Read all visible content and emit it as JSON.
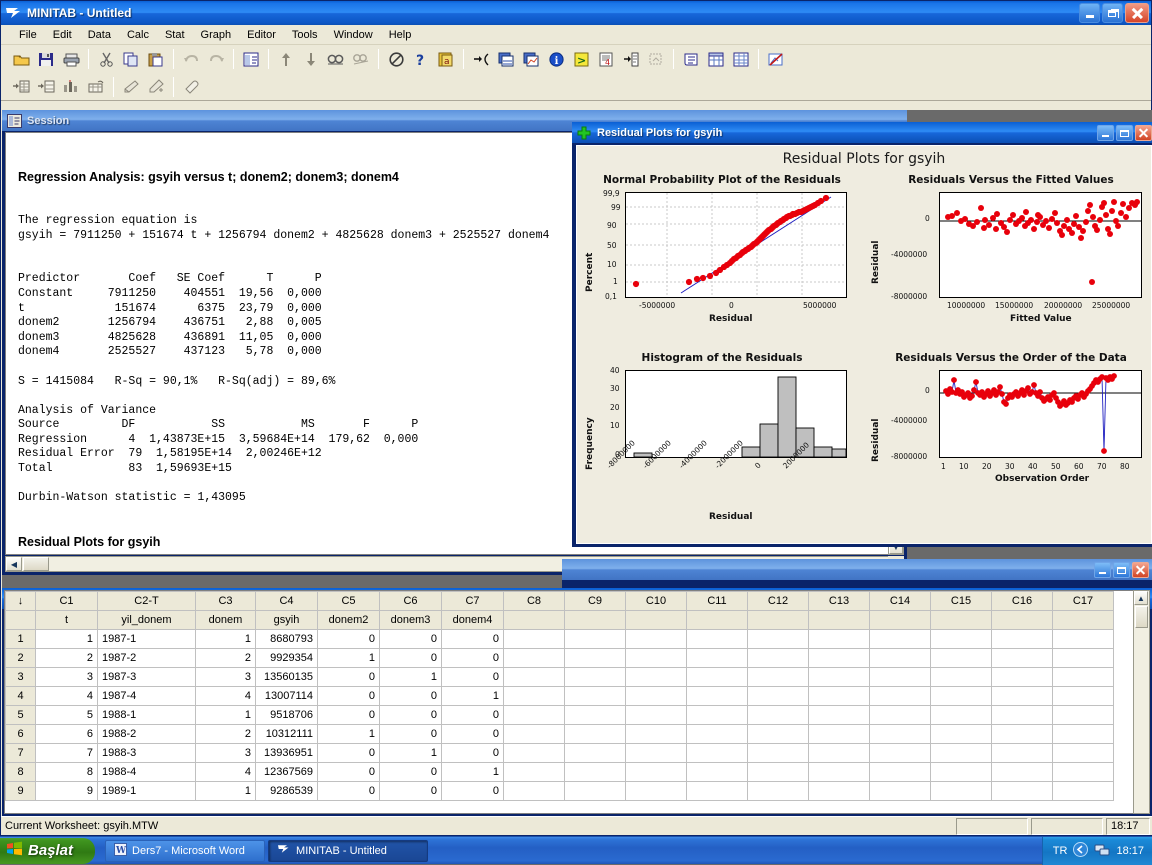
{
  "window": {
    "title": "MINITAB - Untitled",
    "icon": "minitab-icon",
    "buttons": {
      "minimize": "Minimize",
      "restore": "Restore",
      "close": "Close"
    }
  },
  "menubar": {
    "items": [
      "File",
      "Edit",
      "Data",
      "Calc",
      "Stat",
      "Graph",
      "Editor",
      "Tools",
      "Window",
      "Help"
    ]
  },
  "toolbar_main": {
    "icons": [
      "open-folder-icon",
      "save-icon",
      "print-icon",
      "cut-icon",
      "copy-icon",
      "paste-icon",
      "undo-icon",
      "redo-icon",
      "session-window-icon",
      "arrow-up-icon",
      "arrow-down-icon",
      "find-icon",
      "find-next-icon",
      "cancel-icon",
      "help-icon",
      "stat-guide-icon",
      "next-command-icon",
      "new-graph-window-icon",
      "new-graph-icon",
      "info-icon",
      "history-icon",
      "report-pad-icon",
      "copy-to-worksheet-icon",
      "show-graphs-icon",
      "session-icon",
      "project-manager-icon",
      "worksheet-icon",
      "graph-layout-icon"
    ]
  },
  "toolbar_worksheet": {
    "icons": [
      "insert-cells-icon",
      "insert-rows-icon",
      "insert-columns-icon",
      "move-columns-icon",
      "brush-icon",
      "brush-plus-icon",
      "eraser-icon"
    ]
  },
  "session": {
    "title": "Session",
    "icon": "session-window-icon",
    "heading": "Regression Analysis: gsyih versus t; donem2; donem3; donem4",
    "body": "The regression equation is\ngsyih = 7911250 + 151674 t + 1256794 donem2 + 4825628 donem3 + 2525527 donem4\n\n\nPredictor       Coef   SE Coef      T      P\nConstant     7911250    404551  19,56  0,000\nt             151674      6375  23,79  0,000\ndonem2       1256794    436751   2,88  0,005\ndonem3       4825628    436891  11,05  0,000\ndonem4       2525527    437123   5,78  0,000\n\nS = 1415084   R-Sq = 90,1%   R-Sq(adj) = 89,6%\n\nAnalysis of Variance\nSource         DF           SS           MS       F      P\nRegression      4  1,43873E+15  3,59684E+14  179,62  0,000\nResidual Error  79  1,58195E+14  2,00246E+12\nTotal           83  1,59693E+15\n\nDurbin-Watson statistic = 1,43095\n",
    "heading2": "Residual Plots for gsyih"
  },
  "graph_window": {
    "title": "Residual Plots for gsyih",
    "icon": "graph-icon"
  },
  "chart_data": [
    {
      "type": "scatter",
      "panel": "normal-probability-plot",
      "title": "Normal Probability Plot of the Residuals",
      "xlabel": "Residual",
      "ylabel": "Percent",
      "xticks": [
        "-5000000",
        "0",
        "5000000"
      ],
      "xtick_values": [
        -5000000,
        0,
        5000000
      ],
      "yticks": [
        "0,1",
        "1",
        "10",
        "50",
        "90",
        "99",
        "99,9"
      ],
      "ytick_values": [
        0.1,
        1,
        10,
        50,
        90,
        99,
        99.9
      ],
      "xlim": [
        -8500000,
        6000000
      ],
      "grid": true,
      "point_color": "#E8000B",
      "line_color": "#2020C0",
      "reference_line": "normal fit line",
      "n_points": 84
    },
    {
      "type": "scatter",
      "panel": "residuals-vs-fits",
      "title": "Residuals Versus the Fitted Values",
      "xlabel": "Fitted Value",
      "ylabel": "Residual",
      "xticks": [
        "10000000",
        "15000000",
        "20000000",
        "25000000"
      ],
      "xtick_values": [
        10000000,
        15000000,
        20000000,
        25000000
      ],
      "yticks": [
        "0",
        "-4000000",
        "-8000000"
      ],
      "ytick_values": [
        0,
        -4000000,
        -8000000
      ],
      "xlim": [
        7500000,
        26500000
      ],
      "ylim": [
        -9000000,
        3000000
      ],
      "grid": false,
      "point_color": "#E8000B",
      "zero_line": true,
      "n_points": 84
    },
    {
      "type": "bar",
      "panel": "histogram-of-residuals",
      "title": "Histogram of the Residuals",
      "xlabel": "Residual",
      "ylabel": "Frequency",
      "categories": [
        "-8000000",
        "-7000000",
        "-6000000",
        "-5000000",
        "-4000000",
        "-3000000",
        "-2000000",
        "-1000000",
        "0",
        "1000000",
        "2000000",
        "3000000"
      ],
      "values": [
        1,
        0,
        0,
        0,
        0,
        0,
        5,
        16,
        39,
        14,
        5,
        4
      ],
      "xticks": [
        "-8000000",
        "-6000000",
        "-4000000",
        "-2000000",
        "0",
        "2000000"
      ],
      "yticks": [
        "0",
        "10",
        "20",
        "30",
        "40"
      ],
      "ylim": [
        0,
        42
      ],
      "bar_color": "#BFBFBF",
      "bar_edge": "#000000"
    },
    {
      "type": "line",
      "panel": "residuals-vs-order",
      "title": "Residuals Versus the Order of the Data",
      "xlabel": "Observation Order",
      "ylabel": "Residual",
      "xticks": [
        "1",
        "10",
        "20",
        "30",
        "40",
        "50",
        "60",
        "70",
        "80"
      ],
      "xtick_values": [
        1,
        10,
        20,
        30,
        40,
        50,
        60,
        70,
        80
      ],
      "yticks": [
        "0",
        "-4000000",
        "-8000000"
      ],
      "ytick_values": [
        0,
        -4000000,
        -8000000
      ],
      "ylim": [
        -9000000,
        2500000
      ],
      "point_color": "#E8000B",
      "line_color": "#2020C0",
      "zero_line": true,
      "n_points": 84
    }
  ],
  "worksheet": {
    "columns": [
      "",
      "C1",
      "C2-T",
      "C3",
      "C4",
      "C5",
      "C6",
      "C7",
      "C8",
      "C9",
      "C10",
      "C11",
      "C12",
      "C13",
      "C14",
      "C15",
      "C16",
      "C17"
    ],
    "names": [
      "",
      "t",
      "yil_donem",
      "donem",
      "gsyih",
      "donem2",
      "donem3",
      "donem4",
      "",
      "",
      "",
      "",
      "",
      "",
      "",
      "",
      "",
      ""
    ],
    "rows": [
      [
        "1",
        "1",
        "1987-1",
        "1",
        "8680793",
        "0",
        "0",
        "0"
      ],
      [
        "2",
        "2",
        "1987-2",
        "2",
        "9929354",
        "1",
        "0",
        "0"
      ],
      [
        "3",
        "3",
        "1987-3",
        "3",
        "13560135",
        "0",
        "1",
        "0"
      ],
      [
        "4",
        "4",
        "1987-4",
        "4",
        "13007114",
        "0",
        "0",
        "1"
      ],
      [
        "5",
        "5",
        "1988-1",
        "1",
        "9518706",
        "0",
        "0",
        "0"
      ],
      [
        "6",
        "6",
        "1988-2",
        "2",
        "10312111",
        "1",
        "0",
        "0"
      ],
      [
        "7",
        "7",
        "1988-3",
        "3",
        "13936951",
        "0",
        "1",
        "0"
      ],
      [
        "8",
        "8",
        "1988-4",
        "4",
        "12367569",
        "0",
        "0",
        "1"
      ],
      [
        "9",
        "9",
        "1989-1",
        "1",
        "9286539",
        "0",
        "0",
        "0"
      ]
    ]
  },
  "statusbar": {
    "text": "Current Worksheet: gsyih.MTW",
    "clock": "18:17"
  },
  "taskbar": {
    "start_label": "Başlat",
    "tasks": [
      {
        "label": "Ders7 - Microsoft Word",
        "icon": "word-icon",
        "active": false
      },
      {
        "label": "MINITAB - Untitled",
        "icon": "minitab-icon",
        "active": true
      }
    ],
    "tray": {
      "language": "TR",
      "clock": "18:17",
      "icons": [
        "back-arrow-icon",
        "network-icon"
      ]
    }
  }
}
